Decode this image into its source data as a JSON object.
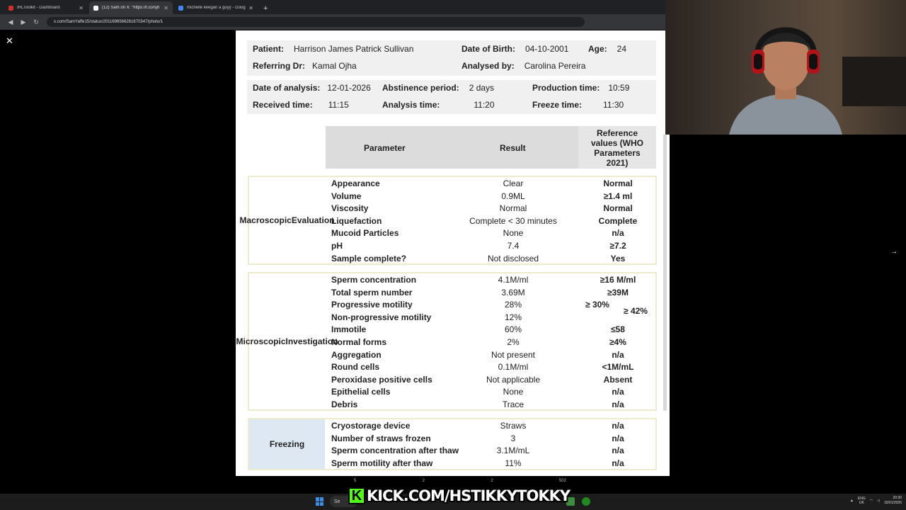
{
  "browser": {
    "tabs": [
      {
        "title": "IRLToolkit - Dashboard",
        "color": "#d0322b"
      },
      {
        "title": "(12) Sam on X: \"https://t.co/sjh",
        "color": "#ffffff"
      },
      {
        "title": "michelle keegan a guyy - Google",
        "color": "#4285f4"
      }
    ],
    "new_tab": "+",
    "url": "x.com/SamYaffe15/status/2011696566261670347/photo/1"
  },
  "viewer": {
    "close": "✕",
    "next": "→"
  },
  "report": {
    "patient_label": "Patient:",
    "patient": "Harrison James Patrick Sullivan",
    "dob_label": "Date of Birth:",
    "dob": "04-10-2001",
    "age_label": "Age:",
    "age": "24",
    "referring_label": "Referring Dr:",
    "referring": "Kamal Ojha",
    "analysed_label": "Analysed by:",
    "analysed": "Carolina Pereira",
    "date_label": "Date of analysis:",
    "date": "12-01-2026",
    "abstinence_label": "Abstinence period:",
    "abstinence": "2 days",
    "production_label": "Production time:",
    "production": "10:59",
    "received_label": "Received time:",
    "received": "11:15",
    "analysis_time_label": "Analysis time:",
    "analysis_time": "11:20",
    "freeze_label": "Freeze time:",
    "freeze": "11:30",
    "col_parameter": "Parameter",
    "col_result": "Result",
    "col_reference": [
      "Reference",
      "values (WHO",
      "Parameters",
      "2021)"
    ],
    "macro": {
      "label": [
        "Macroscopic",
        "Evaluation"
      ],
      "rows": [
        {
          "p": "Appearance",
          "r": "Clear",
          "ref": "Normal"
        },
        {
          "p": "Volume",
          "r": "0.9ML",
          "ref": "≥1.4 ml"
        },
        {
          "p": "Viscosity",
          "r": "Normal",
          "ref": "Normal"
        },
        {
          "p": "Liquefaction",
          "r": "Complete < 30 minutes",
          "ref": "Complete"
        },
        {
          "p": "Mucoid Particles",
          "r": "None",
          "ref": "n/a"
        },
        {
          "p": "pH",
          "r": "7.4",
          "ref": "≥7.2"
        },
        {
          "p": "Sample complete?",
          "r": "Not disclosed",
          "ref": "Yes"
        }
      ]
    },
    "micro": {
      "label": [
        "Microscopic",
        "Investigation"
      ],
      "rows": [
        {
          "p": "Sperm concentration",
          "r": "4.1M/ml",
          "ref": "≥16 M/ml"
        },
        {
          "p": "Total sperm number",
          "r": "3.69M",
          "ref": "≥39M"
        },
        {
          "p": "Progressive motility",
          "r": "28%",
          "ref": "≥ 30%"
        },
        {
          "p": "Non-progressive motility",
          "r": "12%",
          "ref": ""
        },
        {
          "p": "Immotile",
          "r": "60%",
          "ref": "≤58"
        },
        {
          "p": "Normal forms",
          "r": "2%",
          "ref": "≥4%"
        },
        {
          "p": "Aggregation",
          "r": "Not present",
          "ref": "n/a"
        },
        {
          "p": "Round cells",
          "r": "0.1M/ml",
          "ref": "<1M/mL"
        },
        {
          "p": "Peroxidase positive cells",
          "r": "Not applicable",
          "ref": "Absent"
        },
        {
          "p": "Epithelial cells",
          "r": "None",
          "ref": "n/a"
        },
        {
          "p": "Debris",
          "r": "Trace",
          "ref": "n/a"
        }
      ],
      "total_motility_ref": "≥ 42%"
    },
    "freezing": {
      "label": [
        "Freezing"
      ],
      "rows": [
        {
          "p": "Cryostorage device",
          "r": "Straws",
          "ref": "n/a"
        },
        {
          "p": "Number of straws frozen",
          "r": "3",
          "ref": "n/a"
        },
        {
          "p": "Sperm concentration after thaw",
          "r": "3.1M/mL",
          "ref": "n/a"
        },
        {
          "p": "Sperm motility after thaw",
          "r": "11%",
          "ref": "n/a"
        }
      ]
    }
  },
  "post_stats": {
    "replies": "5",
    "reposts": "2",
    "likes": "2",
    "views": "502"
  },
  "banner": {
    "logo": "K",
    "text": "KICK.COM/HSTIKKYTOKKY"
  },
  "taskbar": {
    "search": "Se",
    "lang": [
      "ENG",
      "UK"
    ],
    "time": "20:30",
    "date": "15/01/2026"
  }
}
